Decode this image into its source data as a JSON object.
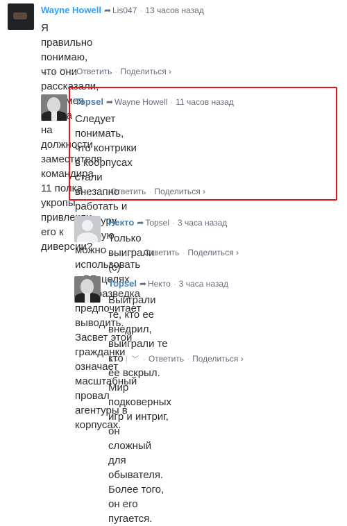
{
  "comments": [
    {
      "author": "Wayne Howell",
      "reply_to": "Lis047",
      "time": "13 часов назад",
      "lines": [
        "Я правильно понимаю, что они рассказали, что имея агента",
        "на должности заместителя командира 11 полка укропы",
        "привлекли его к диверсии?"
      ],
      "vote_count": "",
      "reply_label": "Ответить",
      "share_label": "Поделиться ›"
    },
    {
      "author": "Topsel",
      "reply_to": "Wayne Howell",
      "time": "11 часов назад",
      "lines": [
        "Следует понимать, что контрики в коорпусах стали",
        "внезапно работать и агентуру которую можно",
        "использовать в PR-целях укроразведка предпочитает",
        "выводить. Засвет этой гражданки означает",
        "масштабный провал агентуры в корпусах."
      ],
      "vote_count": "",
      "reply_label": "Ответить",
      "share_label": "Поделиться ›"
    },
    {
      "author": "Некто",
      "reply_to": "Topsel",
      "time": "3 часа назад",
      "lines": [
        "Только выиграли (с)"
      ],
      "vote_count": "",
      "reply_label": "Ответить",
      "share_label": "Поделиться ›"
    },
    {
      "author": "Topsel",
      "reply_to": "Некто",
      "time": "3 часа назад",
      "lines": [
        "Выиграли те, кто ее внедрил, выиграли те кто",
        "ее вскрыл. Мир подковерных игр и интриг, он",
        "сложный для обывателя. Более того, он его",
        "пугается."
      ],
      "vote_count": "1",
      "reply_label": "Ответить",
      "share_label": "Поделиться ›"
    }
  ],
  "icons": {
    "reply_arrow": "reply-arrow-icon",
    "upvote": "upvote-icon",
    "downvote": "downvote-icon"
  },
  "colors": {
    "author": "#2e9fff",
    "highlight_border": "#e3141b",
    "meta_text": "#656c7a"
  }
}
